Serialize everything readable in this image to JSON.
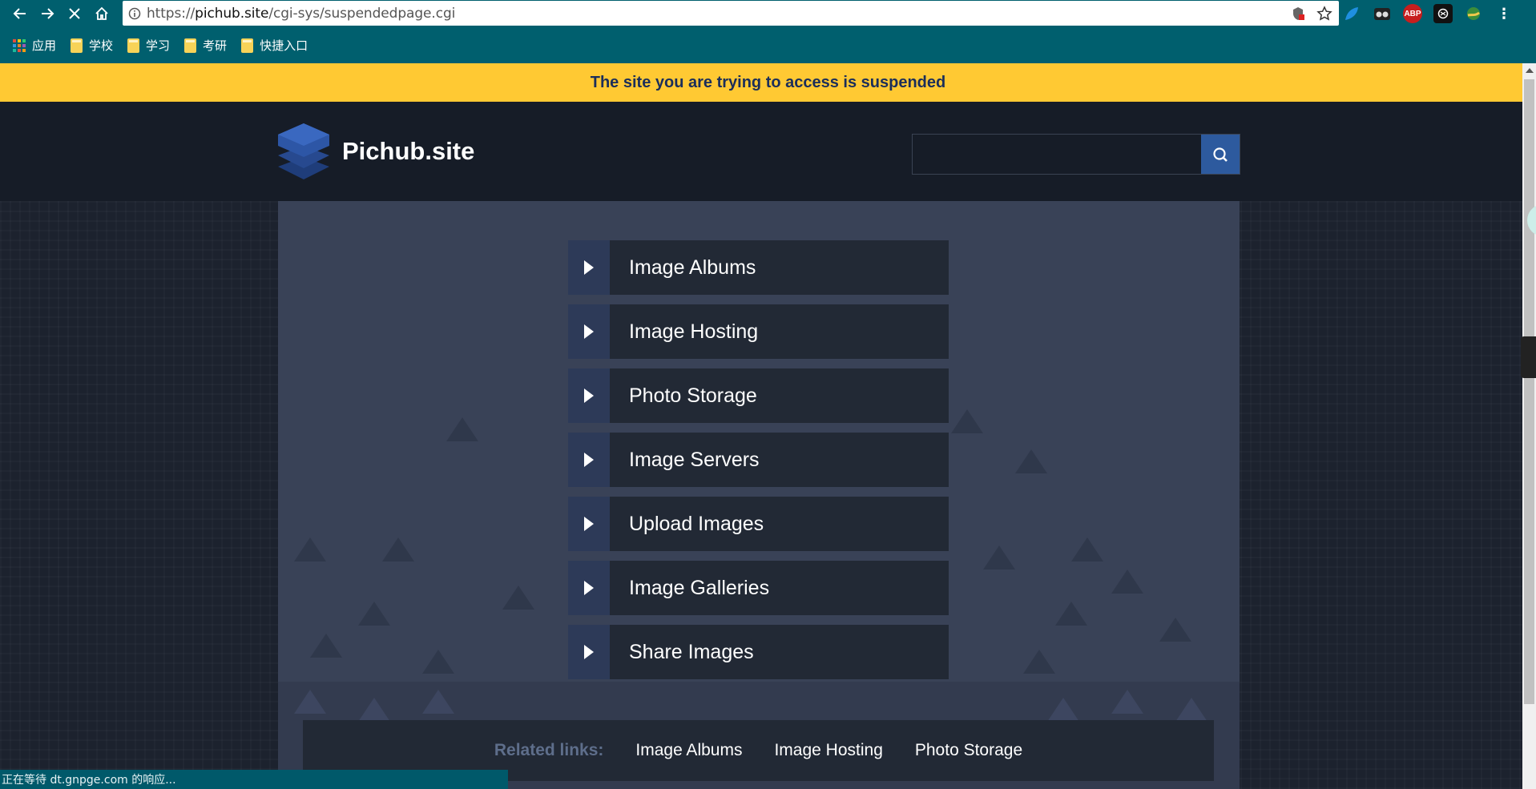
{
  "browser": {
    "url_prefix": "https://",
    "url_host": "pichub.site",
    "url_path": "/cgi-sys/suspendedpage.cgi",
    "extensions": [
      "leaf-extension-icon",
      "glasses-extension-icon",
      "ABP",
      "openai-extension-icon",
      "globe-extension-icon"
    ],
    "bookmarks": [
      {
        "label": "应用",
        "icon": "apps-grid-icon"
      },
      {
        "label": "学校",
        "icon": "folder-icon"
      },
      {
        "label": "学习",
        "icon": "folder-icon"
      },
      {
        "label": "考研",
        "icon": "folder-icon"
      },
      {
        "label": "快捷入口",
        "icon": "folder-icon"
      }
    ],
    "status_text": "正在等待 dt.gnpge.com 的响应..."
  },
  "page": {
    "banner": "The site you are trying to access is suspended",
    "logo_text": "Pichub.site",
    "search_placeholder": "",
    "items": [
      {
        "label": "Image Albums"
      },
      {
        "label": "Image Hosting"
      },
      {
        "label": "Photo Storage"
      },
      {
        "label": "Image Servers"
      },
      {
        "label": "Upload Images"
      },
      {
        "label": "Image Galleries"
      },
      {
        "label": "Share Images"
      }
    ],
    "related_label": "Related links:",
    "related_links": [
      "Image Albums",
      "Image Hosting",
      "Photo Storage"
    ]
  },
  "colors": {
    "chrome": "#005f6e",
    "banner": "#ffc933",
    "header": "#161c27",
    "panel": "#394257",
    "item_bg": "#222935",
    "arrow_bg": "#2d3a58",
    "search_button": "#2d5a9e"
  }
}
